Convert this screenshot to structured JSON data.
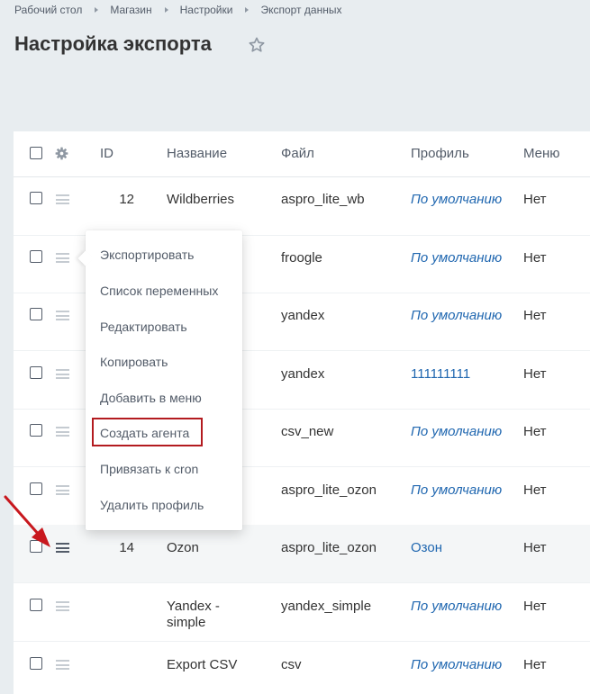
{
  "breadcrumb": [
    "Рабочий стол",
    "Магазин",
    "Настройки",
    "Экспорт данных"
  ],
  "page_title": "Настройка экспорта",
  "table": {
    "headers": {
      "id": "ID",
      "name": "Название",
      "file": "Файл",
      "profile": "Профиль",
      "menu": "Меню"
    },
    "rows": [
      {
        "id": "12",
        "name": "Wildberries",
        "file": "aspro_lite_wb",
        "profile": "По умолчанию",
        "menu": "Нет"
      },
      {
        "id": "",
        "name": "",
        "file": "froogle",
        "profile": "По умолчанию",
        "menu": "Нет"
      },
      {
        "id": "",
        "name": "",
        "file": "yandex",
        "profile": "По умолчанию",
        "menu": "Нет"
      },
      {
        "id": "",
        "name": "",
        "file": "yandex",
        "profile": "111111111",
        "menu": "Нет"
      },
      {
        "id": "",
        "name": "",
        "file": "csv_new",
        "profile": "По умолчанию",
        "menu": "Нет"
      },
      {
        "id": "",
        "name": "",
        "file": "aspro_lite_ozon",
        "profile": "По умолчанию",
        "menu": "Нет"
      },
      {
        "id": "14",
        "name": "Ozon",
        "file": "aspro_lite_ozon",
        "profile": "Озон",
        "menu": "Нет"
      },
      {
        "id": "",
        "name": "Yandex - simple",
        "file": "yandex_simple",
        "profile": "По умолчанию",
        "menu": "Нет"
      },
      {
        "id": "",
        "name": "Export CSV",
        "file": "csv",
        "profile": "По умолчанию",
        "menu": "Нет"
      }
    ]
  },
  "context_menu": {
    "items": [
      "Экспортировать",
      "Список переменных",
      "Редактировать",
      "Копировать",
      "Добавить в меню",
      "Создать агента",
      "Привязать к cron",
      "Удалить профиль"
    ],
    "highlighted_item": "Создать агента"
  },
  "colors": {
    "accent_link": "#2067b0",
    "highlight_border": "#b31b20",
    "arrow": "#c8181e",
    "page_bg": "#e8edf0"
  },
  "icons": {
    "favorite": "star-icon",
    "settings": "gear-icon",
    "row_menu": "hamburger-icon",
    "pointer": "red-arrow-icon"
  }
}
